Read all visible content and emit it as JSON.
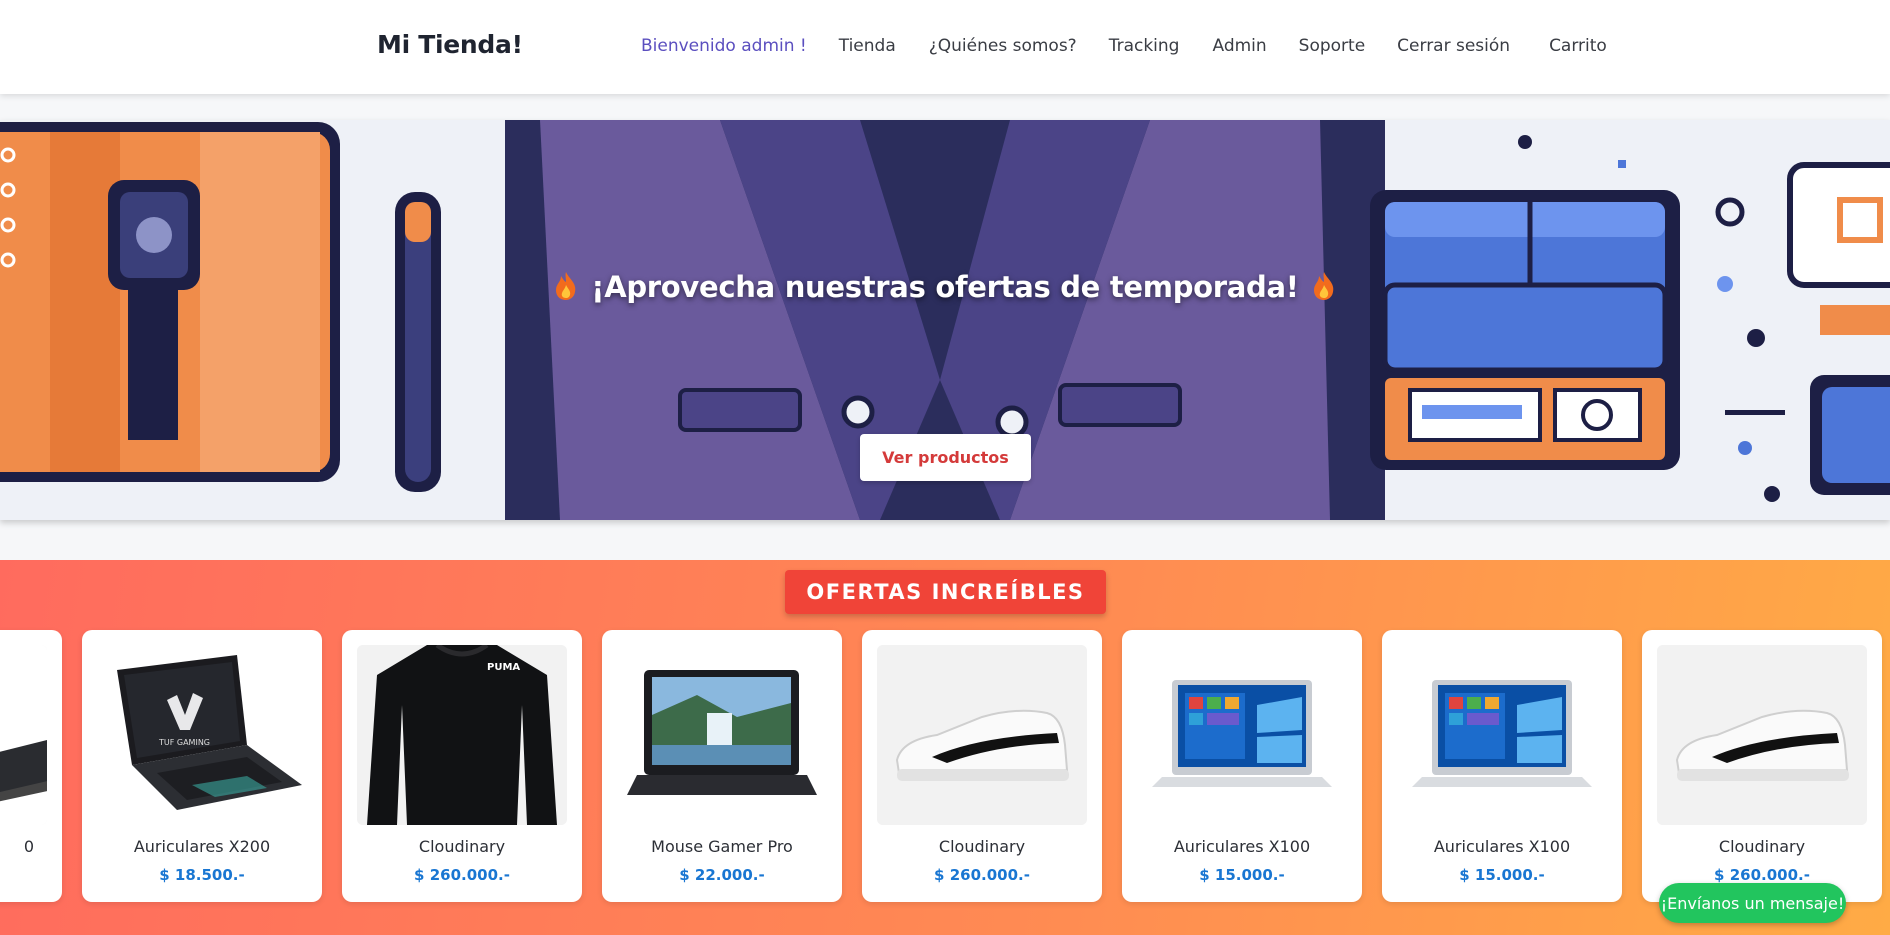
{
  "header": {
    "brand": "Mi Tienda!",
    "nav": {
      "welcome": "Bienvenido admin !",
      "tienda": "Tienda",
      "quienes": "¿Quiénes somos?",
      "tracking": "Tracking",
      "admin": "Admin",
      "soporte": "Soporte",
      "cerrar": "Cerrar sesión",
      "carrito": "Carrito"
    }
  },
  "hero": {
    "title": "¡Aprovecha nuestras ofertas de temporada!",
    "button": "Ver productos"
  },
  "offers": {
    "badge": "OFERTAS INCREÍBLES",
    "products": [
      {
        "name": "Auriculares X200",
        "price": "$ 18.500.-",
        "image": "laptop-gaming"
      },
      {
        "name": "Cloudinary",
        "price": "$ 260.000.-",
        "image": "sweatshirt"
      },
      {
        "name": "Mouse Gamer Pro",
        "price": "$ 22.000.-",
        "image": "laptop-landscape"
      },
      {
        "name": "Cloudinary",
        "price": "$ 260.000.-",
        "image": "sneaker"
      },
      {
        "name": "Auriculares X100",
        "price": "$ 15.000.-",
        "image": "laptop-windows"
      },
      {
        "name": "Auriculares X100",
        "price": "$ 15.000.-",
        "image": "laptop-windows"
      },
      {
        "name": "Cloudinary",
        "price": "$ 260.000.-",
        "image": "sneaker"
      }
    ],
    "partial_card": {
      "name": "0"
    }
  },
  "chat_button": "¡Envíanos un mensaje!",
  "colors": {
    "accent": "#5b4fbf",
    "price": "#1976d2",
    "badge": "#f04438",
    "chat": "#22c55e"
  }
}
